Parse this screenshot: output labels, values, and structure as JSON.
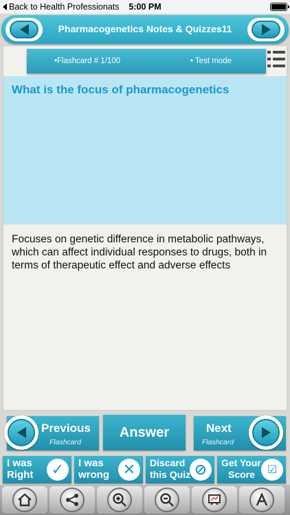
{
  "status_bar": {
    "back_label": "Back to Health Professionats",
    "time": "5:00 PM"
  },
  "title_bar": {
    "title": "Pharmacogenetics Notes & Quizzes11"
  },
  "info_bar": {
    "flashcard": "•Flashcard #  1/100",
    "mode": "• Test mode"
  },
  "card": {
    "question": "What is the focus of pharmacogenetics",
    "answer": "Focuses on genetic difference in metabolic pathways, which can affect individual responses to drugs, both in terms of therapeutic effect and adverse effects"
  },
  "nav": {
    "previous_label": "Previous",
    "previous_sub": "Flashcard",
    "answer_label": "Answer",
    "next_label": "Next",
    "next_sub": "Flashcard"
  },
  "quiz_buttons": [
    {
      "line1": "I was",
      "line2": "Right",
      "icon": "check-icon"
    },
    {
      "line1": "I was",
      "line2": "wrong",
      "icon": "x-icon"
    },
    {
      "line1": "Discard",
      "line2": "this Quiz",
      "icon": "prohibit-icon"
    },
    {
      "line1": "Get Your",
      "line2": "Score",
      "icon": "score-icon"
    }
  ],
  "toolbar": {
    "icons": [
      "home-icon",
      "share-icon",
      "zoom-in-icon",
      "zoom-out-icon",
      "whiteboard-icon",
      "font-icon"
    ]
  },
  "colors": {
    "accent": "#2aa7c2",
    "question_bg": "#b9e6f3",
    "question_text": "#1d95d2"
  }
}
